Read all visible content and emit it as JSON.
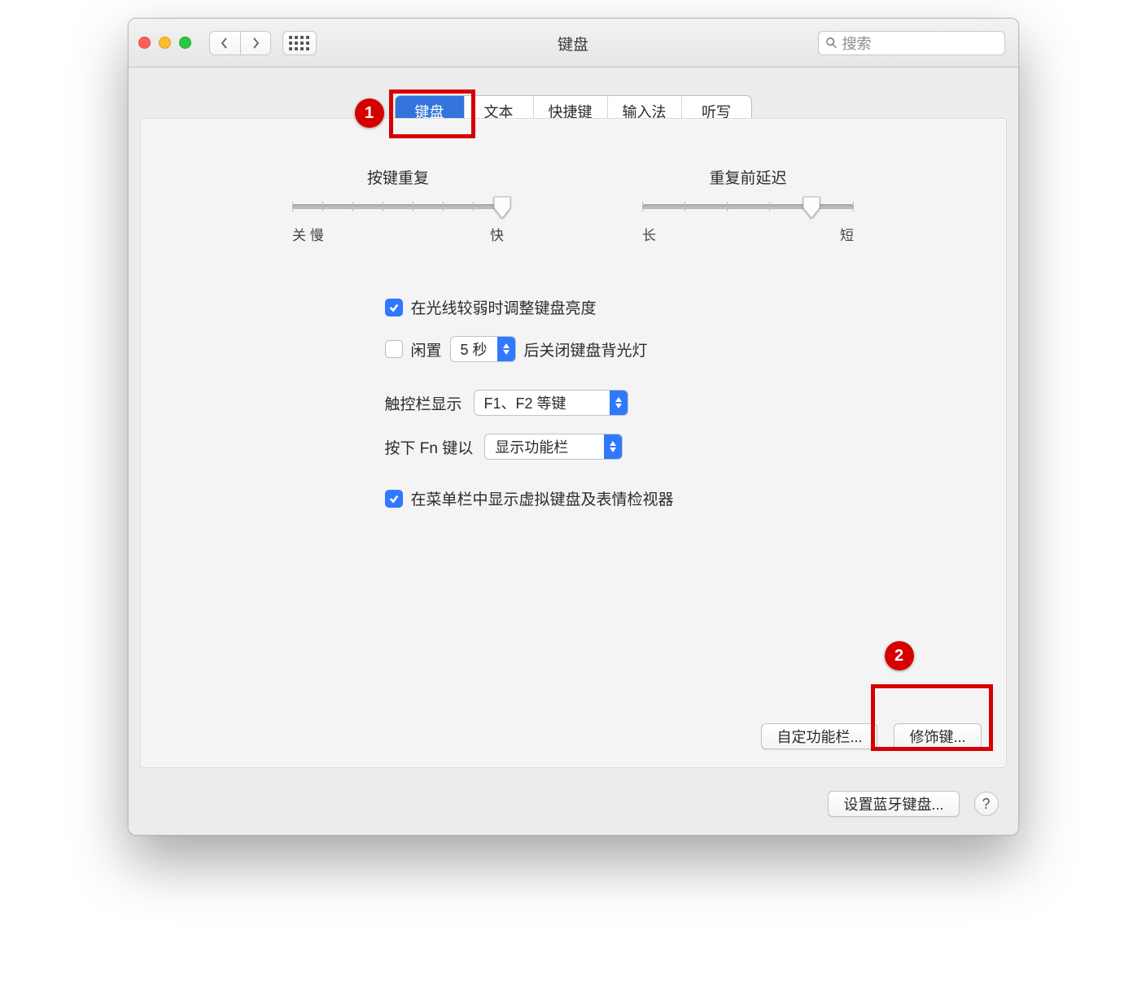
{
  "window": {
    "title": "键盘"
  },
  "search": {
    "placeholder": "搜索"
  },
  "tabs": [
    "键盘",
    "文本",
    "快捷键",
    "输入法",
    "听写"
  ],
  "activeTabIndex": 0,
  "sliders": {
    "repeat": {
      "title": "按键重复",
      "leftLabel": "关 慢",
      "rightLabel": "快"
    },
    "delay": {
      "title": "重复前延迟",
      "leftLabel": "长",
      "rightLabel": "短"
    }
  },
  "options": {
    "adjustBrightness": {
      "checked": true,
      "label": "在光线较弱时调整键盘亮度"
    },
    "idleOff": {
      "checked": false,
      "prefix": "闲置",
      "selectValue": "5 秒",
      "suffix": "后关闭键盘背光灯"
    },
    "touchbar": {
      "label": "触控栏显示",
      "selectValue": "F1、F2 等键"
    },
    "fnKey": {
      "label": "按下 Fn 键以",
      "selectValue": "显示功能栏"
    },
    "menubar": {
      "checked": true,
      "label": "在菜单栏中显示虚拟键盘及表情检视器"
    }
  },
  "buttons": {
    "customize": "自定功能栏...",
    "modifier": "修饰键...",
    "bluetooth": "设置蓝牙键盘..."
  },
  "annotations": {
    "c1": "1",
    "c2": "2"
  }
}
